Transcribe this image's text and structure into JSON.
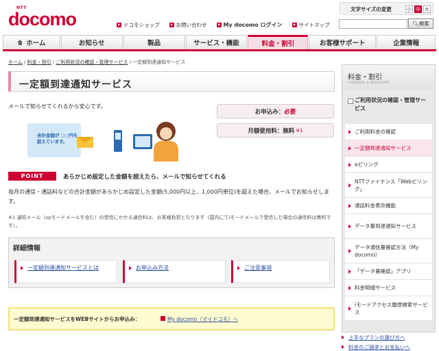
{
  "header": {
    "logo_ntt": "NTT",
    "logo": "docomo",
    "font_size_label": "文字サイズの変更",
    "font_sizes": [
      "小",
      "中",
      "大"
    ],
    "top_links": [
      "ドコモショップ",
      "お問い合わせ",
      "My docomo ログイン",
      "サイトマップ"
    ],
    "search_placeholder": "",
    "search_button": "検索"
  },
  "nav": {
    "items": [
      "ホーム",
      "お知らせ",
      "製品",
      "サービス・機能",
      "料金・割引",
      "お客様サポート",
      "企業情報"
    ],
    "active_index": 4
  },
  "breadcrumb": {
    "items": [
      "ホーム",
      "料金・割引",
      "ご利用状況の確認・管理サービス"
    ],
    "current": "一定額到達通知サービス"
  },
  "main": {
    "title": "一定額到達通知サービス",
    "intro": "メールで知らせてくれるから安心です。",
    "apply_label": "お申込み：",
    "apply_value": "必要",
    "fee_label": "月額使用料：",
    "fee_value": "無料",
    "fee_note": "※1",
    "illustration_text": "合計金額が ○○円を 超えています。",
    "point_badge": "POINT",
    "point_text": "あらかじめ設定した金額を超えたら、メールで知らせてくれる",
    "description": "毎月の通信・通話料などの合計金額があらかじめ設定した金額(5,000円以上、1,000円単位)を超えた場合、メールでお知らせします。",
    "footnote": "※1 通知メール（spモードメールを含む）の受信にかかる通信料は、お客様負担となります（国内にてiモードメールで受信した場合の通信料は無料です）。"
  },
  "details": {
    "title": "詳細情報",
    "links": [
      "一定額到達通知サービスとは",
      "お申込み方法",
      "ご注意事項"
    ]
  },
  "apply_bar": {
    "text": "一定額到達通知サービスをWEBサイトからお申込み：",
    "link": "My docomo（マイドコモ）へ"
  },
  "sidebar": {
    "title": "料金・割引",
    "subtitle": "CHARGES & DISCOUNT",
    "section": "ご利用状況の確認・管理サービス",
    "items": [
      "ご利用料金の確認",
      "一定額到達通知サービス",
      "eビリング",
      "NTTファイナンス「Webビリング」",
      "通話料金表示機能",
      "データ量到達通知サービス",
      "データ通信量確認方法（My docomo）",
      "「データ量確認」アプリ",
      "料金明細サービス",
      "iモードアクセス履歴検索サービス"
    ],
    "active_index": 1,
    "bottom_links": [
      "上手なプランの選び方へ",
      "料金のご請求とお支払いへ"
    ]
  },
  "colors": {
    "brand": "#cc0033",
    "link": "#2a4ca0",
    "apply_bg": "#fffbd0"
  }
}
